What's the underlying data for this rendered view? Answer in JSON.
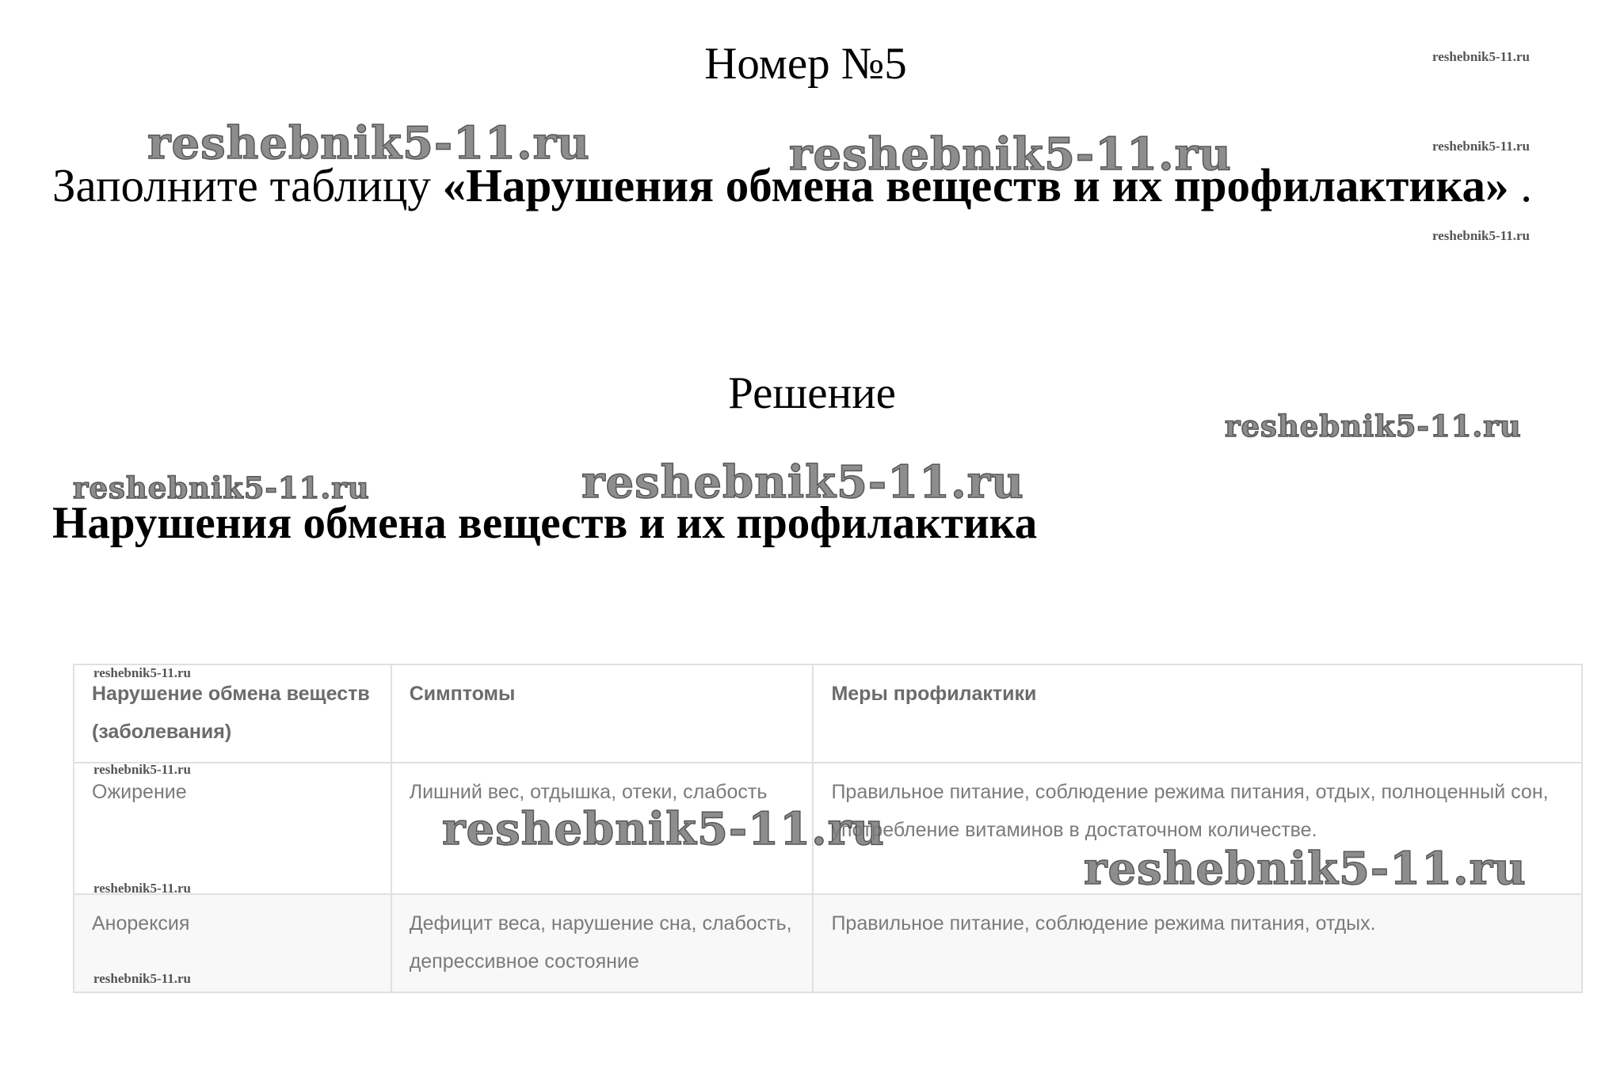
{
  "task": {
    "title": "Номер №5",
    "text_prefix": "Заполните таблицу ",
    "text_bold": "«Нарушения обмена веществ и их профилактика»",
    "text_suffix": " ."
  },
  "solution": {
    "title": "Решение",
    "table_title": "Нарушения обмена веществ и их профилактика"
  },
  "table": {
    "headers": [
      "Нарушение обмена веществ (заболевания)",
      "Симптомы",
      "Меры профилактики"
    ],
    "rows": [
      [
        "Ожирение",
        "Лишний вес, отдышка, отеки, слабость",
        "Правильное питание, соблюдение режима питания, отдых, полноценный сон, употребление витаминов в достаточном количестве."
      ],
      [
        "Анорексия",
        "Дефицит веса, нарушение сна, слабость, депрессивное состояние",
        "Правильное питание, соблюдение режима питания, отдых."
      ]
    ]
  },
  "watermark": "reshebnik5-11.ru"
}
